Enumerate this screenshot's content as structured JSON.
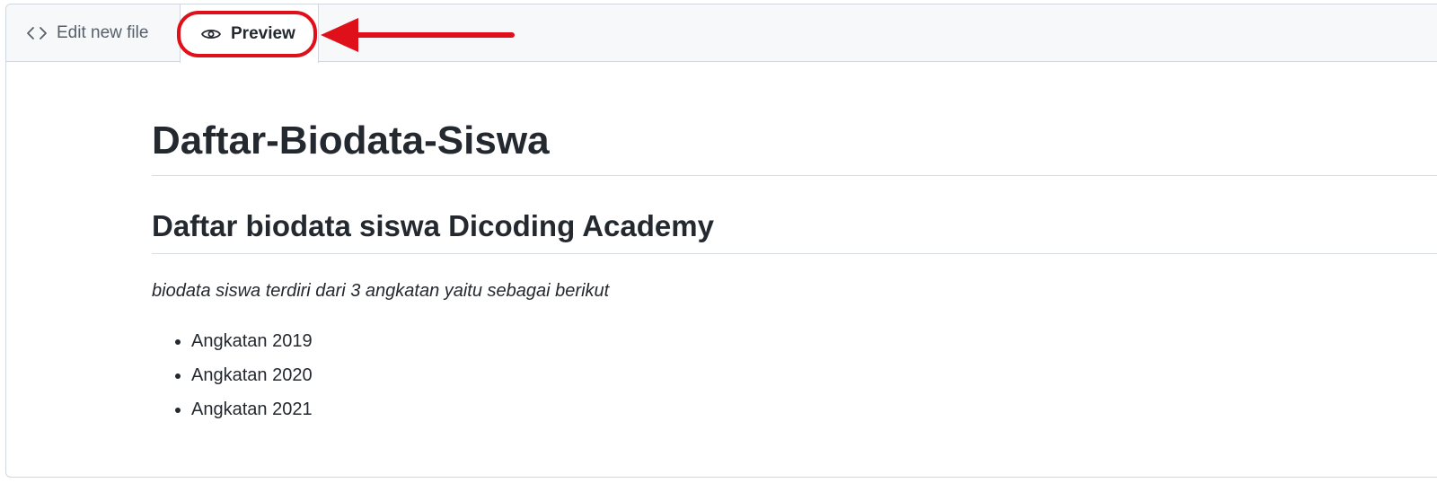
{
  "tabs": {
    "edit_label": "Edit new file",
    "preview_label": "Preview",
    "edit_icon": "code-icon",
    "preview_icon": "eye-icon",
    "active": "Preview"
  },
  "annotation": {
    "ring_color": "#e0101a",
    "arrow_color": "#e0101a"
  },
  "document": {
    "title": "Daftar-Biodata-Siswa",
    "subtitle": "Daftar biodata siswa Dicoding Academy",
    "description": "biodata siswa terdiri dari 3 angkatan yaitu sebagai berikut",
    "items": [
      "Angkatan 2019",
      "Angkatan 2020",
      "Angkatan 2021"
    ]
  }
}
